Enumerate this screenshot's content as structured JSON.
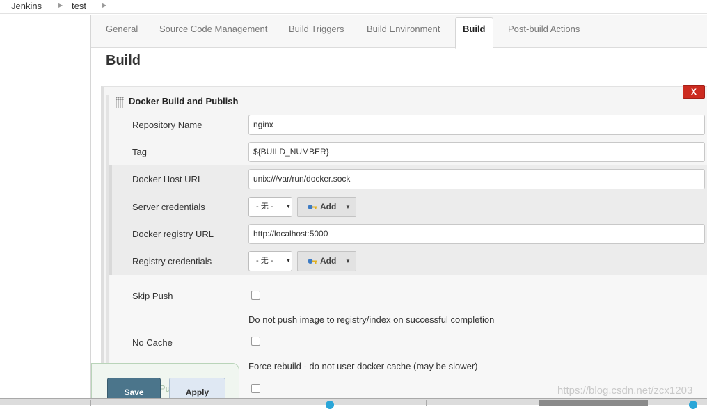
{
  "breadcrumb": {
    "items": [
      "Jenkins",
      "test"
    ]
  },
  "tabs": [
    {
      "label": "General"
    },
    {
      "label": "Source Code Management"
    },
    {
      "label": "Build Triggers"
    },
    {
      "label": "Build Environment"
    },
    {
      "label": "Build"
    },
    {
      "label": "Post-build Actions"
    }
  ],
  "section": {
    "title": "Build"
  },
  "builder": {
    "title": "Docker Build and Publish",
    "delete_label": "X",
    "repository_name": {
      "label": "Repository Name",
      "value": "nginx"
    },
    "tag": {
      "label": "Tag",
      "value": "${BUILD_NUMBER}"
    },
    "docker_host_uri": {
      "label": "Docker Host URI",
      "value": "unix:///var/run/docker.sock"
    },
    "server_credentials": {
      "label": "Server credentials",
      "selected": "- 无 -",
      "add_label": "Add"
    },
    "registry_url": {
      "label": "Docker registry URL",
      "value": "http://localhost:5000"
    },
    "registry_credentials": {
      "label": "Registry credentials",
      "selected": "- 无 -",
      "add_label": "Add"
    },
    "skip_push": {
      "label": "Skip Push",
      "description": "Do not push image to registry/index on successful completion"
    },
    "no_cache": {
      "label": "No Cache",
      "description": "Force rebuild - do not user docker cache (may be slower)"
    }
  },
  "footer": {
    "save_label": "Save",
    "apply_label": "Apply",
    "ghost_text": "Pu"
  },
  "watermark": "https://blog.csdn.net/zcx1203",
  "colors": {
    "delete_button": "#cc2b20",
    "save_button": "#4b758b",
    "apply_button": "#dfe8f3",
    "active_tab_text": "#222222"
  }
}
